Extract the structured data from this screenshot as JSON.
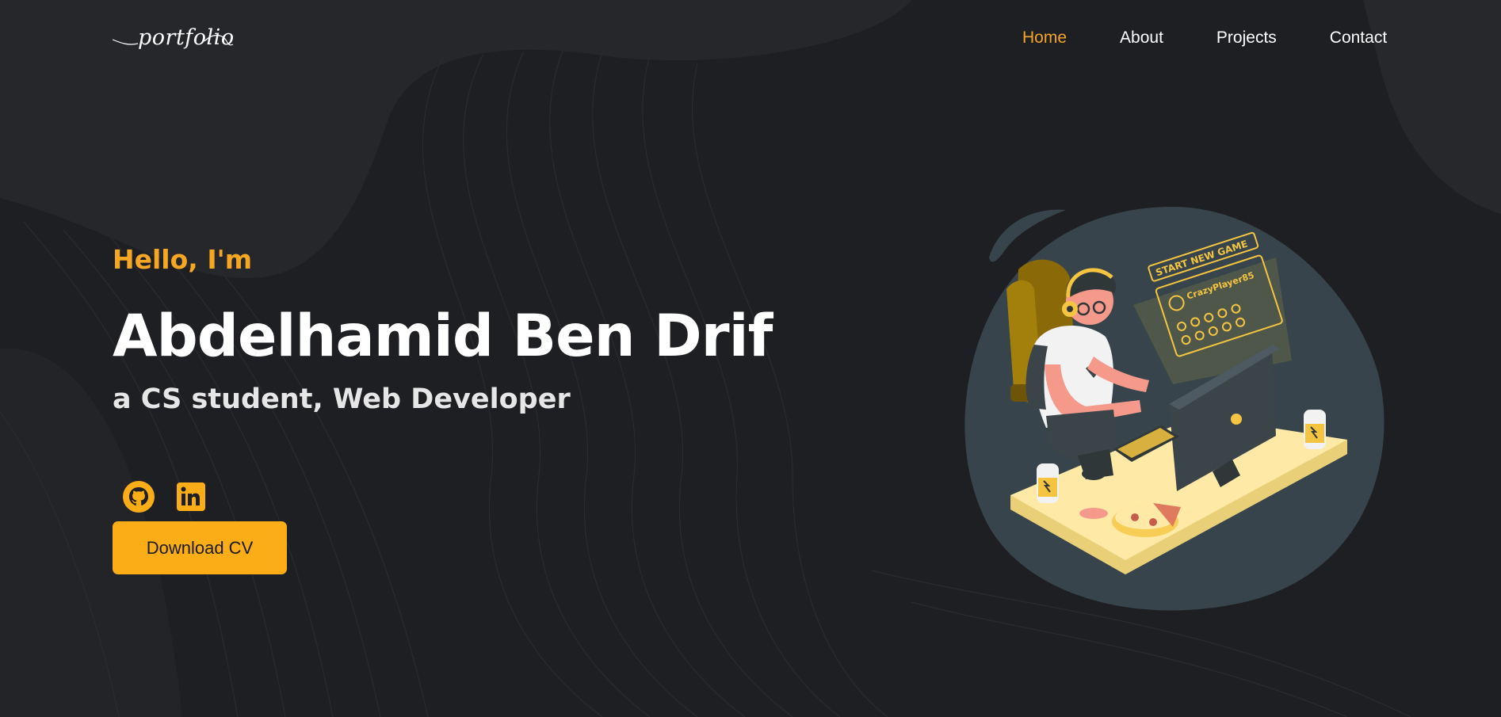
{
  "brand": {
    "logo_text": "portfolio"
  },
  "nav": {
    "items": [
      {
        "label": "Home",
        "active": true
      },
      {
        "label": "About",
        "active": false
      },
      {
        "label": "Projects",
        "active": false
      },
      {
        "label": "Contact",
        "active": false
      }
    ]
  },
  "hero": {
    "greeting": "Hello, I'm",
    "name": "Abdelhamid Ben Drif",
    "subtitle": "a CS student, Web Developer",
    "cv_button": "Download CV",
    "socials": [
      {
        "icon": "github-icon"
      },
      {
        "icon": "linkedin-icon"
      }
    ]
  },
  "illustration": {
    "panel_title": "START NEW GAME",
    "player_name": "CrazyPlayer85"
  },
  "colors": {
    "background": "#1e1f22",
    "accent": "#f5a623",
    "button": "#fbad17",
    "text": "#ffffff"
  }
}
